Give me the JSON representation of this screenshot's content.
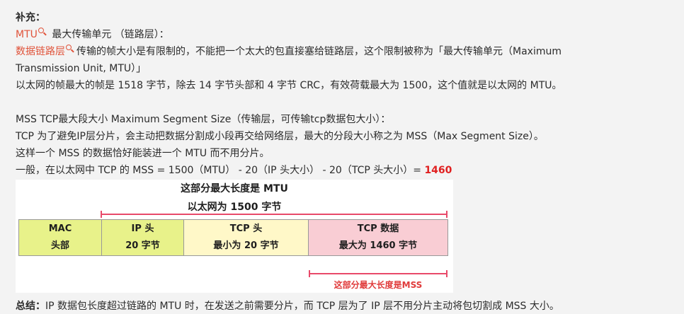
{
  "heading": "补充：",
  "mtu_line": {
    "link": "MTU",
    "text": "最大传输单元 （链路层）："
  },
  "datalink_line": {
    "link": "数据链路层",
    "text": "传输的帧大小是有限制的，不能把一个太大的包直接塞给链路层，这个限制被称为「最大传输单元（Maximum",
    "text_cont": "Transmission Unit, MTU）」"
  },
  "ethernet_line": "以太网的帧最大的帧是 1518 字节，除去 14 字节头部和 4 字节 CRC，有效荷载最大为 1500，这个值就是以太网的 MTU。",
  "mss_heading": "MSS TCP最大段大小 Maximum Segment Size（传输层，可传输tcp数据包大小）：",
  "tcp_line": "TCP 为了避免IP层分片，会主动把数据分割成小段再交给网络层，最大的分段大小称之为 MSS（Max Segment Size）。",
  "mss_fit_line": "这样一个 MSS 的数据恰好能装进一个 MTU 而不用分片。",
  "calc_line": {
    "text": "一般，在以太网中 TCP 的 MSS = 1500（MTU） - 20（IP 头大小） - 20（TCP 头大小）= ",
    "result": "1460"
  },
  "diagram": {
    "title1": "这部分最大长度是 MTU",
    "title2": "以太网为 1500 字节",
    "cells": [
      {
        "line1": "MAC",
        "line2": "头部"
      },
      {
        "line1": "IP 头",
        "line2": "20 字节"
      },
      {
        "line1": "TCP 头",
        "line2": "最小为 20 字节"
      },
      {
        "line1": "TCP 数据",
        "line2": "最大为 1460 字节"
      }
    ],
    "mss_label": "这部分最大长度是MSS"
  },
  "summary": {
    "label": "总结：",
    "text": "IP 数据包长度超过链路的 MTU 时，在发送之前需要分片，而 TCP 层为了 IP 层不用分片主动将包切割成 MSS 大小。"
  },
  "colors": {
    "link": "#e0533a",
    "highlight": "#e02020",
    "mac_ip": "#e8f28a",
    "tcp_header": "#fff8c8",
    "tcp_data": "#f9cdd4",
    "bracket": "#e84a6a"
  }
}
